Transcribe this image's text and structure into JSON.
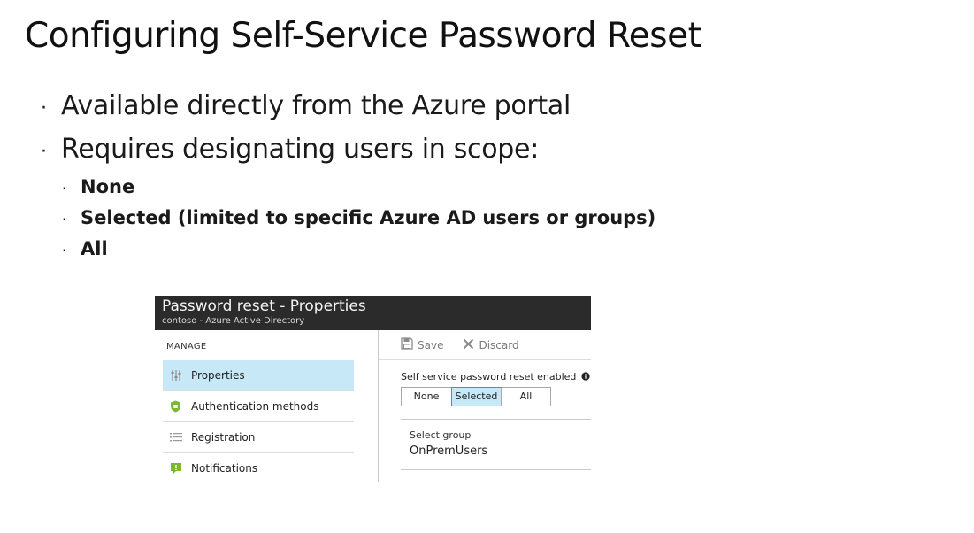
{
  "slide": {
    "title": "Configuring Self-Service Password Reset",
    "bullets": [
      "Available directly from the Azure portal",
      "Requires designating users in scope:"
    ],
    "sub_bullets": [
      "None",
      "Selected (limited to specific Azure AD users or groups)",
      "All"
    ],
    "bullet_glyph": "·"
  },
  "portal": {
    "title": "Password reset - Properties",
    "subtitle": "contoso - Azure Active Directory",
    "manage_label": "MANAGE",
    "nav_items": [
      {
        "label": "Properties",
        "icon": "sliders-icon",
        "active": true
      },
      {
        "label": "Authentication methods",
        "icon": "shield-icon",
        "active": false
      },
      {
        "label": "Registration",
        "icon": "list-icon",
        "active": false
      },
      {
        "label": "Notifications",
        "icon": "notification-icon",
        "active": false
      }
    ],
    "toolbar": {
      "save": "Save",
      "discard": "Discard"
    },
    "sspr_label": "Self service password reset enabled",
    "sspr_options": [
      "None",
      "Selected",
      "All"
    ],
    "sspr_selected": "Selected",
    "select_group_label": "Select group",
    "select_group_value": "OnPremUsers",
    "colors": {
      "header_bg": "#2b2b2b",
      "active_bg": "#c7e8f6",
      "shield_green": "#7bb92f"
    }
  }
}
